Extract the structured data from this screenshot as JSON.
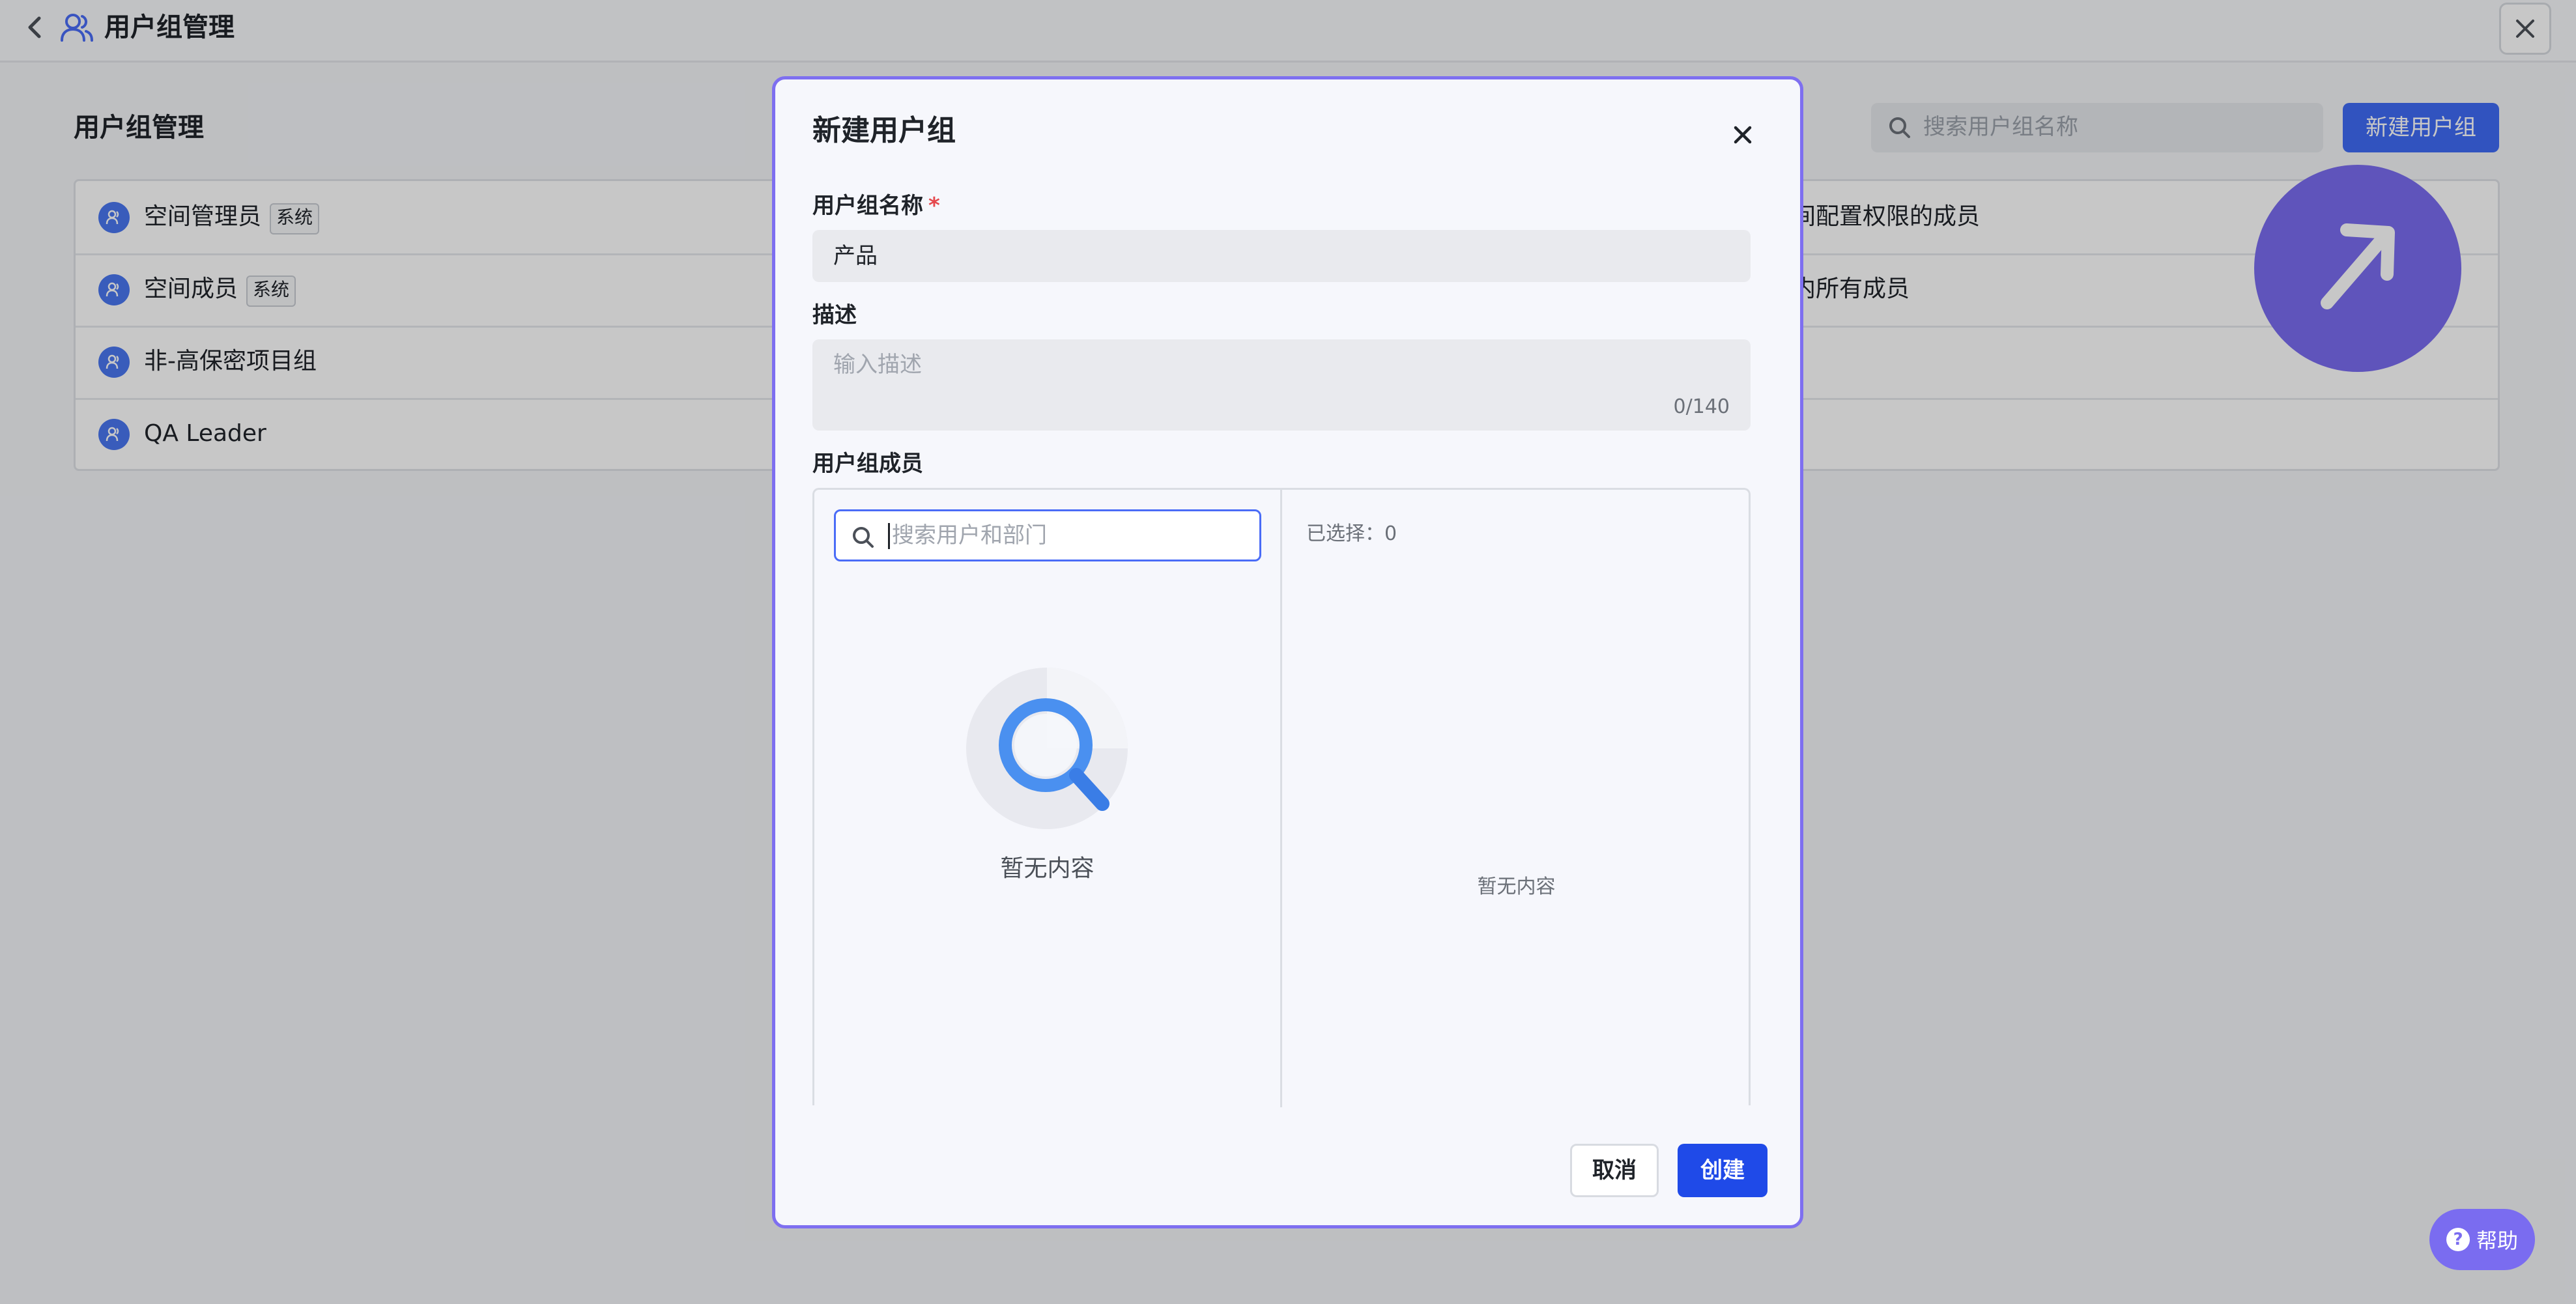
{
  "colors": {
    "accent": "#3f6bf5",
    "primary_button": "#1f4ae8",
    "modal_border": "#7e6ff0",
    "help_bg": "#7a6cf0",
    "required": "#e5484d"
  },
  "header": {
    "title": "用户组管理",
    "icons": [
      "chevron-left-icon",
      "user-group-icon",
      "close-icon"
    ]
  },
  "page": {
    "section_title": "用户组管理",
    "search_placeholder": "搜索用户组名称",
    "new_group_label": "新建用户组",
    "groups": [
      {
        "name": "空间管理员",
        "tag": "系统",
        "desc": "间配置权限的成员"
      },
      {
        "name": "空间成员",
        "tag": "系统",
        "desc": "内所有成员"
      },
      {
        "name": "非-高保密项目组",
        "tag": "",
        "desc": ""
      },
      {
        "name": "QA Leader",
        "tag": "",
        "desc": ""
      }
    ]
  },
  "dialog": {
    "title": "新建用户组",
    "name_label": "用户组名称",
    "required_mark": "*",
    "name_value": "产品",
    "desc_label": "描述",
    "desc_placeholder": "输入描述",
    "desc_counter": "0/140",
    "members_label": "用户组成员",
    "members_search_placeholder": "搜索用户和部门",
    "empty_text": "暂无内容",
    "selected_label": "已选择：0",
    "right_empty_text": "暂无内容",
    "cancel_label": "取消",
    "create_label": "创建"
  },
  "help": {
    "label": "帮助"
  }
}
